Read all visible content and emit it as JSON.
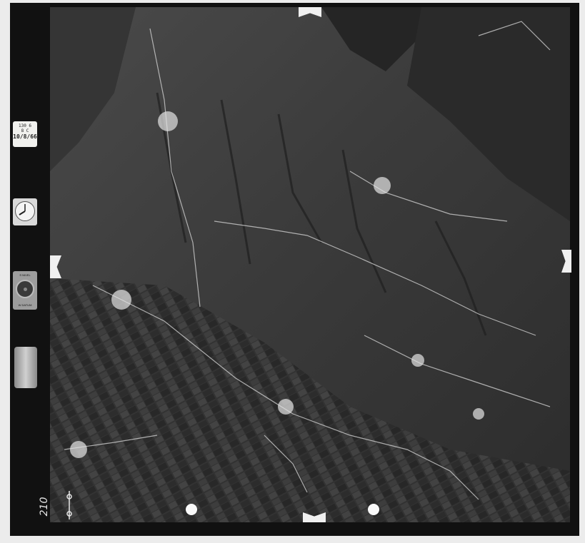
{
  "film": {
    "frame_number": "210",
    "stamp_lines": [
      "130 6",
      "8 C"
    ],
    "stamp_date": "10/8/66",
    "level_top": "S NIVEL",
    "level_bottom": "W DATUM"
  },
  "colors": {
    "frame": "#111111",
    "border": "#ececec",
    "terrain_dark": "#2f2f2f",
    "terrain_light": "#5a5a5a",
    "roads": "#d8d8d8"
  }
}
